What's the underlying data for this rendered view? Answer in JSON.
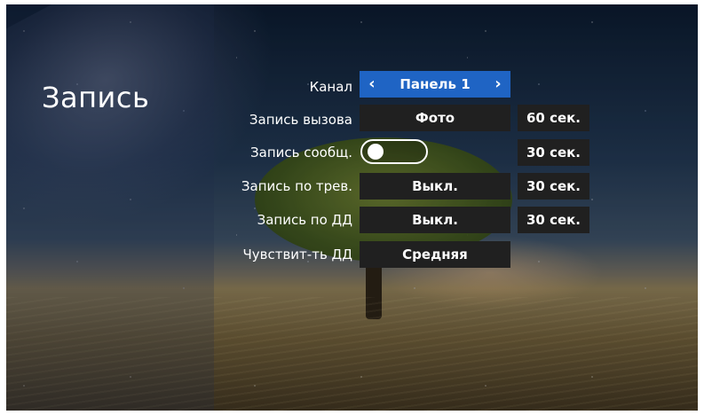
{
  "screen": {
    "title": "Запись"
  },
  "settings": {
    "channel": {
      "label": "Канал",
      "value": "Панель 1"
    },
    "call_record": {
      "label": "Запись вызова",
      "mode": "Фото",
      "duration": "60 сек."
    },
    "message_record": {
      "label": "Запись сообщ.",
      "enabled": false,
      "duration": "30 сек."
    },
    "alarm_record": {
      "label": "Запись по трев.",
      "mode": "Выкл.",
      "duration": "30 сек."
    },
    "motion_record": {
      "label": "Запись по ДД",
      "mode": "Выкл.",
      "duration": "30 сек."
    },
    "motion_sensitivity": {
      "label": "Чувствит-ть ДД",
      "value": "Средняя"
    }
  },
  "icons": {
    "prev": "chevron-left-icon",
    "next": "chevron-right-icon"
  },
  "colors": {
    "selected_bg": "#1f64c4",
    "cell_bg": "#202020",
    "text": "#ffffff"
  }
}
